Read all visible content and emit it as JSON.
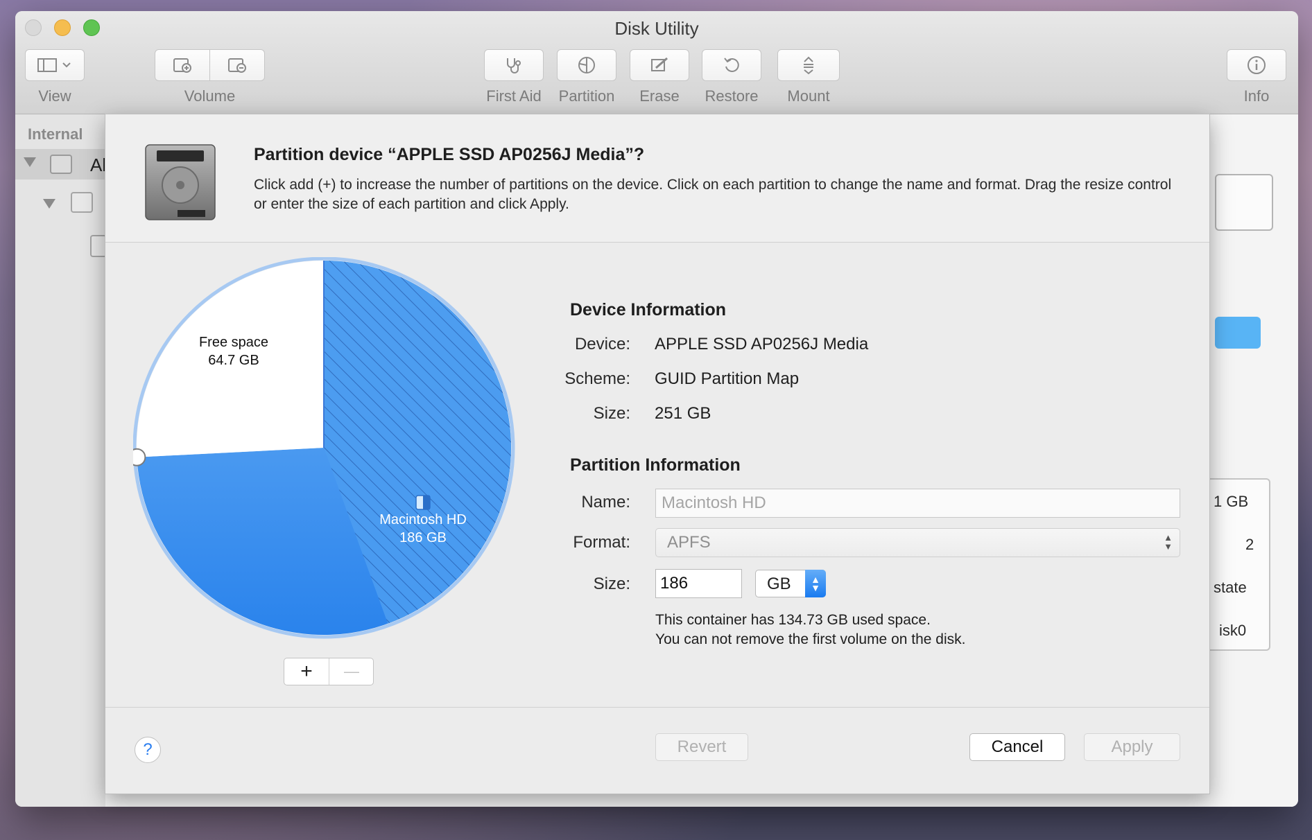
{
  "window": {
    "title": "Disk Utility"
  },
  "toolbar": {
    "view_label": "View",
    "volume_label": "Volume",
    "first_aid_label": "First Aid",
    "partition_label": "Partition",
    "erase_label": "Erase",
    "restore_label": "Restore",
    "mount_label": "Mount",
    "info_label": "Info"
  },
  "sidebar": {
    "section": "Internal",
    "item_partial": "Al"
  },
  "background_panel": {
    "peek_1": "1 GB",
    "peek_2": "2",
    "peek_3": "state",
    "peek_4": "isk0"
  },
  "sheet": {
    "title": "Partition device “APPLE SSD AP0256J Media”?",
    "description": "Click add (+) to increase the number of partitions on the device. Click on each partition to change the name and format. Drag the resize control or enter the size of each partition and click Apply."
  },
  "pie": {
    "free_label": "Free space",
    "free_size": "64.7 GB",
    "free_gb": 64.7,
    "used_label": "Macintosh HD",
    "used_size": "186 GB",
    "used_gb": 186,
    "colors": {
      "used": "#4b9cf0",
      "free": "#ffffff",
      "ring": "#a7c9f2"
    }
  },
  "device_info": {
    "heading": "Device Information",
    "device_label": "Device:",
    "device_value": "APPLE SSD AP0256J Media",
    "scheme_label": "Scheme:",
    "scheme_value": "GUID Partition Map",
    "size_label": "Size:",
    "size_value": "251 GB"
  },
  "partition_info": {
    "heading": "Partition Information",
    "name_label": "Name:",
    "name_placeholder": "Macintosh HD",
    "format_label": "Format:",
    "format_value": "APFS",
    "size_label": "Size:",
    "size_value": "186",
    "unit_value": "GB",
    "note_line1": "This container has 134.73 GB used space.",
    "note_line2": "You can not remove the first volume on the disk."
  },
  "controls": {
    "add": "+",
    "remove": "—"
  },
  "footer": {
    "help": "?",
    "revert": "Revert",
    "cancel": "Cancel",
    "apply": "Apply"
  }
}
